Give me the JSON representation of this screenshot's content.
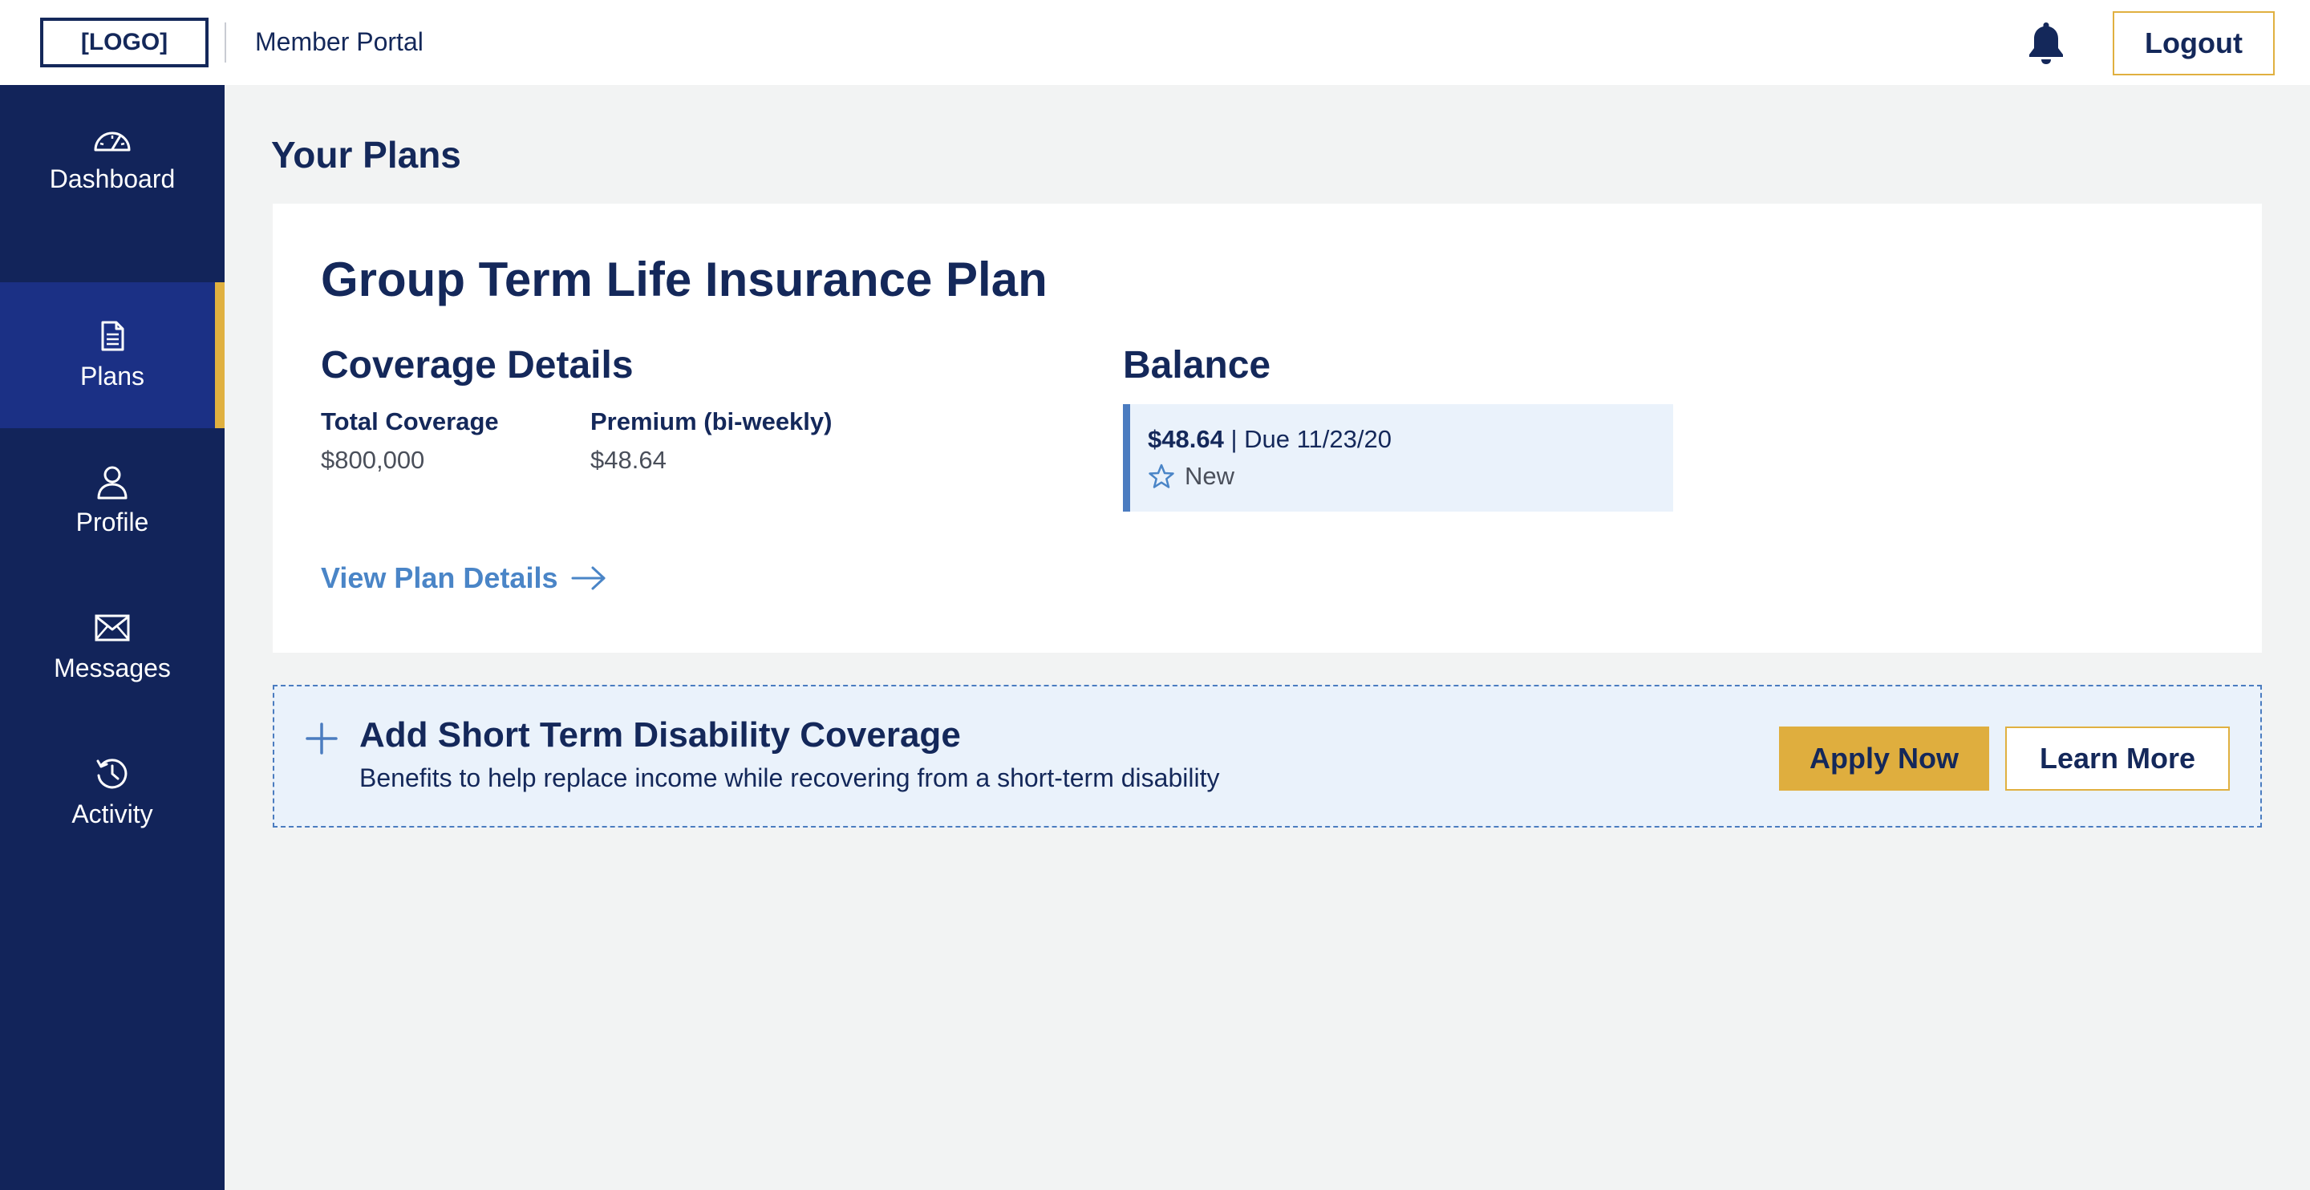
{
  "header": {
    "logo": "[LOGO]",
    "portal_title": "Member Portal",
    "notifications_icon": "bell-icon",
    "logout_label": "Logout"
  },
  "sidebar": {
    "items": [
      {
        "label": "Dashboard",
        "icon": "gauge-icon",
        "active": false
      },
      {
        "label": "Plans",
        "icon": "document-icon",
        "active": true
      },
      {
        "label": "Profile",
        "icon": "user-icon",
        "active": false
      },
      {
        "label": "Messages",
        "icon": "envelope-icon",
        "active": false
      },
      {
        "label": "Activity",
        "icon": "history-icon",
        "active": false
      }
    ]
  },
  "main": {
    "heading": "Your Plans",
    "plan": {
      "title": "Group Term Life Insurance Plan",
      "coverage_heading": "Coverage Details",
      "total_coverage_label": "Total Coverage",
      "total_coverage_value": "$800,000",
      "premium_label": "Premium (bi-weekly)",
      "premium_value": "$48.64",
      "balance_heading": "Balance",
      "balance_amount": "$48.64",
      "balance_due": " | Due 11/23/20",
      "balance_status": "New",
      "view_details_label": "View Plan Details"
    },
    "add_coverage": {
      "title": "Add Short Term Disability Coverage",
      "description": "Benefits to help replace income while recovering from a short-term disability",
      "apply_label": "Apply Now",
      "learn_label": "Learn More"
    }
  },
  "colors": {
    "navy": "#12245a",
    "active_nav": "#1b3085",
    "accent_gold": "#dfae3e",
    "link_blue": "#4a85c7",
    "light_blue_bg": "#eaf2fb",
    "page_bg": "#f2f3f3"
  }
}
